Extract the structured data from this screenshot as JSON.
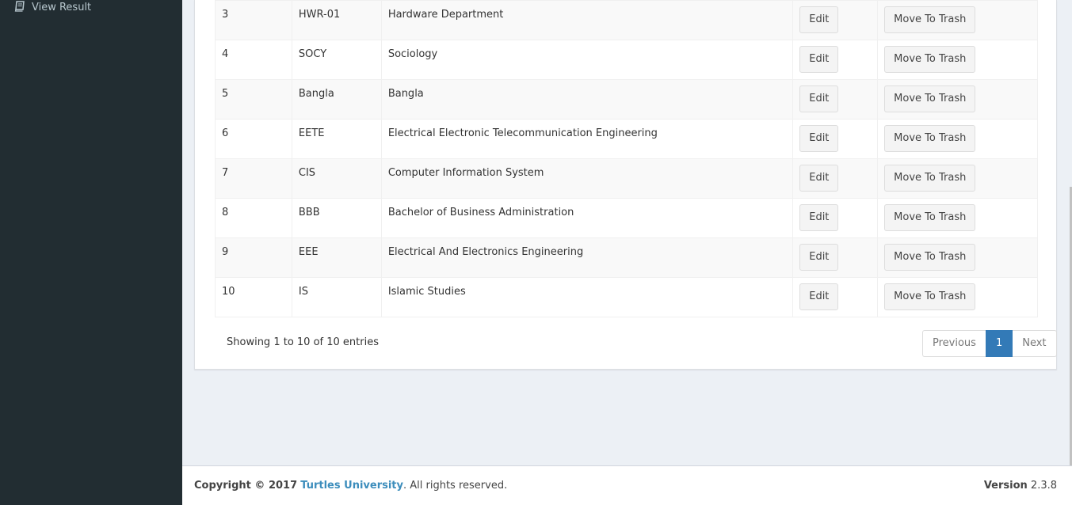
{
  "sidebar": {
    "view_result_label": "View Result"
  },
  "table": {
    "rows": [
      {
        "num": "3",
        "code": "HWR-01",
        "name": "Hardware Department",
        "edit": "Edit",
        "trash": "Move To Trash"
      },
      {
        "num": "4",
        "code": "SOCY",
        "name": "Sociology",
        "edit": "Edit",
        "trash": "Move To Trash"
      },
      {
        "num": "5",
        "code": "Bangla",
        "name": "Bangla",
        "edit": "Edit",
        "trash": "Move To Trash"
      },
      {
        "num": "6",
        "code": "EETE",
        "name": "Electrical Electronic Telecommunication Engineering",
        "edit": "Edit",
        "trash": "Move To Trash"
      },
      {
        "num": "7",
        "code": "CIS",
        "name": "Computer Information System",
        "edit": "Edit",
        "trash": "Move To Trash"
      },
      {
        "num": "8",
        "code": "BBB",
        "name": "Bachelor of Business Administration",
        "edit": "Edit",
        "trash": "Move To Trash"
      },
      {
        "num": "9",
        "code": "EEE",
        "name": "Electrical And Electronics Engineering",
        "edit": "Edit",
        "trash": "Move To Trash"
      },
      {
        "num": "10",
        "code": "IS",
        "name": "Islamic Studies",
        "edit": "Edit",
        "trash": "Move To Trash"
      }
    ],
    "info": "Showing 1 to 10 of 10 entries"
  },
  "pagination": {
    "previous": "Previous",
    "current": "1",
    "next": "Next"
  },
  "footer": {
    "copyright_prefix": "Copyright © 2017",
    "org_name": "Turtles University",
    "rights": ". All rights reserved.",
    "version_label": "Version",
    "version_value": "2.3.8"
  },
  "colors": {
    "sidebar_bg": "#222d32",
    "accent": "#337ab7",
    "link": "#3c8dbc"
  }
}
